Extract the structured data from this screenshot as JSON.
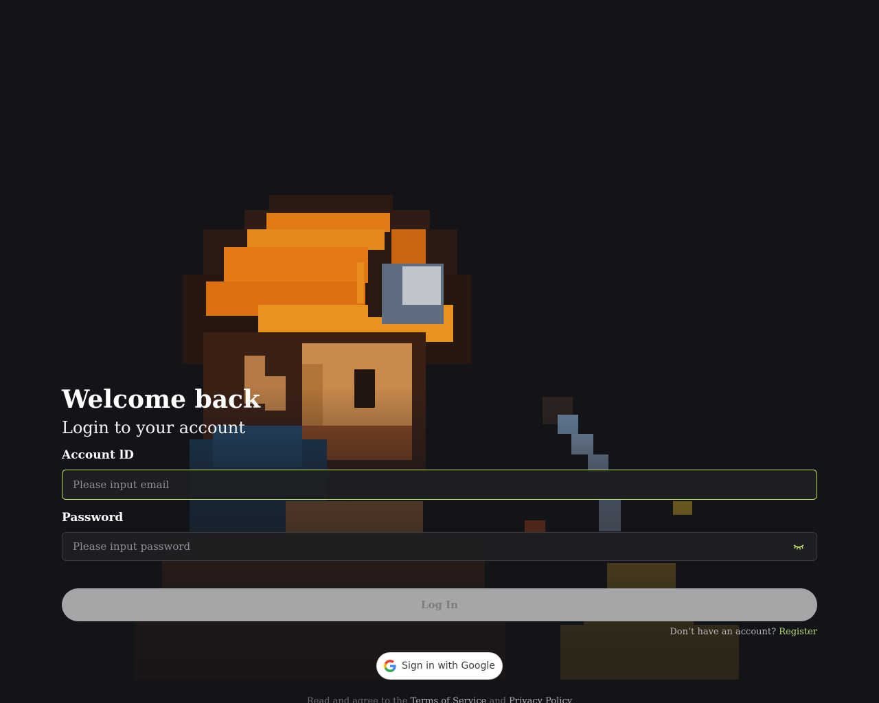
{
  "login": {
    "title": "Welcome back",
    "subtitle": "Login to your account",
    "account_label": "Account lD",
    "email_placeholder": "Please input email",
    "password_label": "Password",
    "password_placeholder": "Please input password",
    "login_button": "Log In",
    "no_account_text": "Don’t have an account?",
    "register_link": "Register",
    "google_button": "Sign in with Google"
  },
  "footer": {
    "prefix": "Read and agree to the",
    "terms": "Terms of Service",
    "and": "and",
    "privacy": "Privacy Policy"
  },
  "colors": {
    "background": "#131418",
    "accent": "#b8e35a",
    "button_disabled": "#a6a6a8"
  },
  "icons": {
    "password_toggle": "eye-closed-icon",
    "google": "google-g-icon"
  }
}
